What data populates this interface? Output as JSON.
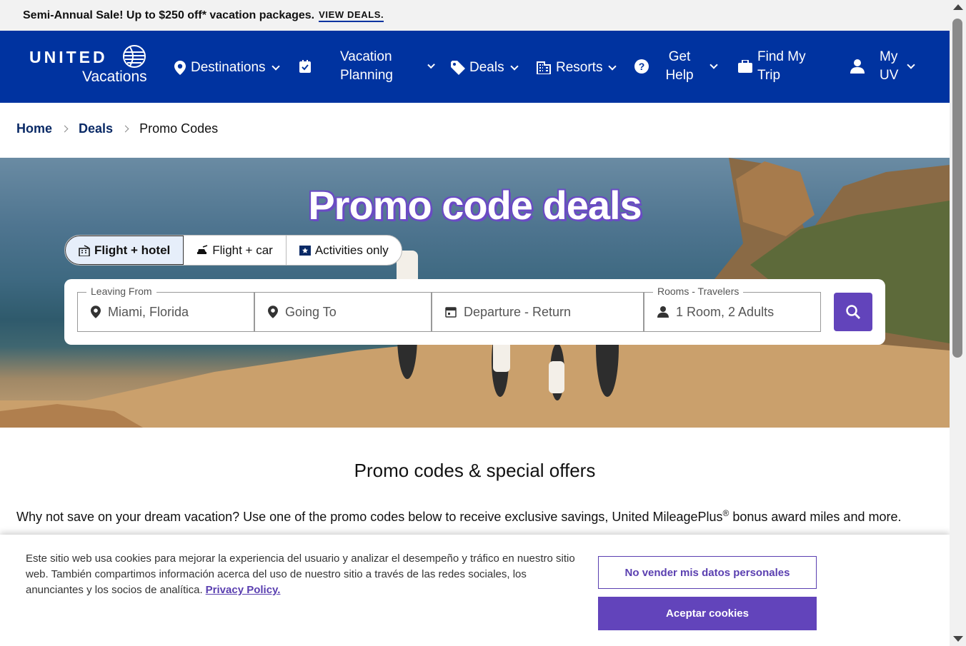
{
  "promo": {
    "text": "Semi-Annual Sale! Up to $250 off* vacation packages.",
    "link": "VIEW DEALS."
  },
  "nav": {
    "logo_brand": "UNITED",
    "logo_sub": "Vacations",
    "items": [
      {
        "label": "Destinations",
        "icon": "map-pin-icon"
      },
      {
        "label": "Vacation Planning",
        "icon": "checklist-icon"
      },
      {
        "label": "Deals",
        "icon": "tag-icon"
      },
      {
        "label": "Resorts",
        "icon": "building-icon"
      },
      {
        "label": "Get Help",
        "icon": "help-icon"
      },
      {
        "label": "Find My Trip",
        "icon": "briefcase-icon"
      },
      {
        "label": "My UV",
        "icon": "user-icon"
      }
    ]
  },
  "breadcrumb": {
    "home": "Home",
    "deals": "Deals",
    "current": "Promo Codes"
  },
  "hero": {
    "title": "Promo code deals"
  },
  "tabs": [
    {
      "label": "Flight + hotel",
      "active": true
    },
    {
      "label": "Flight + car",
      "active": false
    },
    {
      "label": "Activities only",
      "active": false
    }
  ],
  "search": {
    "leaving_label": "Leaving From",
    "leaving_value": "Miami, Florida",
    "going_placeholder": "Going To",
    "dates_placeholder": "Departure - Return",
    "rooms_label": "Rooms - Travelers",
    "rooms_value": "1 Room, 2 Adults"
  },
  "content": {
    "section_title": "Promo codes & special offers",
    "intro_before": "Why not save on your dream vacation? Use one of the promo codes below to receive exclusive savings, United MileagePlus",
    "intro_sup": "®",
    "intro_after": " bonus award miles and more."
  },
  "cookie": {
    "text": "Este sitio web usa cookies para mejorar la experiencia del usuario y analizar el desempeño y tráfico en nuestro sitio web. También compartimos información acerca del uso de nuestro sitio a través de las redes sociales, los anunciantes y los socios de analítica.",
    "policy_link": "Privacy Policy.",
    "decline_button": "No vender mis datos personales",
    "accept_button": "Aceptar cookies"
  },
  "colors": {
    "nav_bg": "#0033a0",
    "accent": "#6244bb",
    "breadcrumb_link": "#0a2a66"
  }
}
